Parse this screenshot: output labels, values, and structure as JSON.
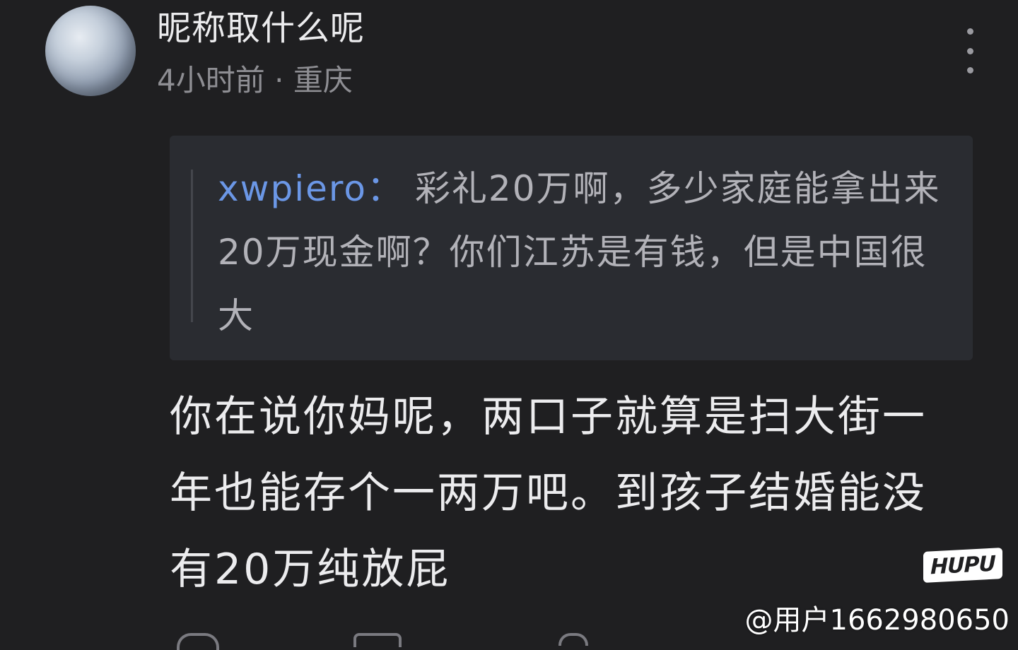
{
  "header": {
    "username": "昵称取什么呢",
    "time": "4小时前",
    "separator": "·",
    "location": "重庆",
    "more_icon": "more-vertical-icon"
  },
  "quote": {
    "author": "xwpiero",
    "colon": "：",
    "text": "彩礼20万啊，多少家庭能拿出来20万现金啊？你们江苏是有钱，但是中国很大"
  },
  "comment": {
    "text": "你在说你妈呢，两口子就算是扫大街一年也能存个一两万吧。到孩子结婚能没有20万纯放屁"
  },
  "logo": {
    "text": "HUPU"
  },
  "watermark": {
    "text": "@用户1662980650"
  },
  "colors": {
    "background": "#1f1f21",
    "quote_background": "#2a2c31",
    "author_link": "#6b97e6",
    "meta_text": "#8e8e93"
  }
}
